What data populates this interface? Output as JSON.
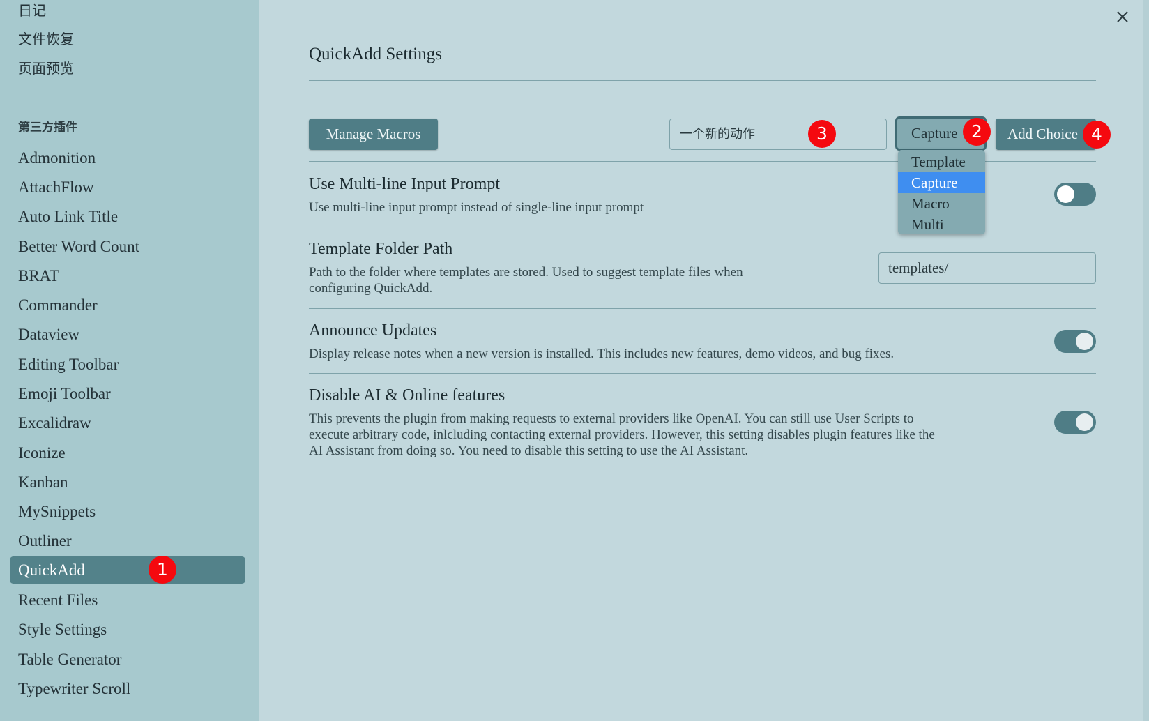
{
  "sidebar": {
    "core_items_top": [
      "日记",
      "文件恢复",
      "页面预览"
    ],
    "section_heading": "第三方插件",
    "plugins": [
      "Admonition",
      "AttachFlow",
      "Auto Link Title",
      "Better Word Count",
      "BRAT",
      "Commander",
      "Dataview",
      "Editing Toolbar",
      "Emoji Toolbar",
      "Excalidraw",
      "Iconize",
      "Kanban",
      "MySnippets",
      "Outliner",
      "QuickAdd",
      "Recent Files",
      "Style Settings",
      "Table Generator",
      "Typewriter Scroll"
    ],
    "active_plugin": "QuickAdd"
  },
  "close_icon": "close-icon",
  "page": {
    "title": "QuickAdd Settings"
  },
  "toolbar": {
    "manage_macros_label": "Manage Macros",
    "choice_name_value": "一个新的动作",
    "choice_type_value": "Capture",
    "add_choice_label": "Add Choice",
    "type_options": [
      "Template",
      "Capture",
      "Macro",
      "Multi"
    ],
    "selected_type_index": 1
  },
  "settings": [
    {
      "name": "Use Multi-line Input Prompt",
      "desc": "Use multi-line input prompt instead of single-line input prompt",
      "toggle": false
    },
    {
      "name": "Template Folder Path",
      "desc_line1": "Path to the folder where templates are stored. Used to suggest template files when",
      "desc_line2": "configuring QuickAdd.",
      "input_value": "templates/"
    },
    {
      "name": "Announce Updates",
      "desc": "Display release notes when a new version is installed. This includes new features, demo videos, and bug fixes.",
      "toggle": true
    },
    {
      "name": "Disable AI & Online features",
      "desc_line1": "This prevents the plugin from making requests to external providers like OpenAI. You can still use User Scripts to",
      "desc_line2": "execute arbitrary code, inlcluding contacting external providers. However, this setting disables plugin features like the",
      "desc_line3": "AI Assistant from doing so. You need to disable this setting to use the AI Assistant.",
      "toggle": true
    }
  ],
  "annotations": [
    "1",
    "2",
    "3",
    "4"
  ],
  "colors": {
    "badge": "#f5090f",
    "accent": "#4f7d86",
    "dropdown_highlight": "#3f8ef0"
  }
}
